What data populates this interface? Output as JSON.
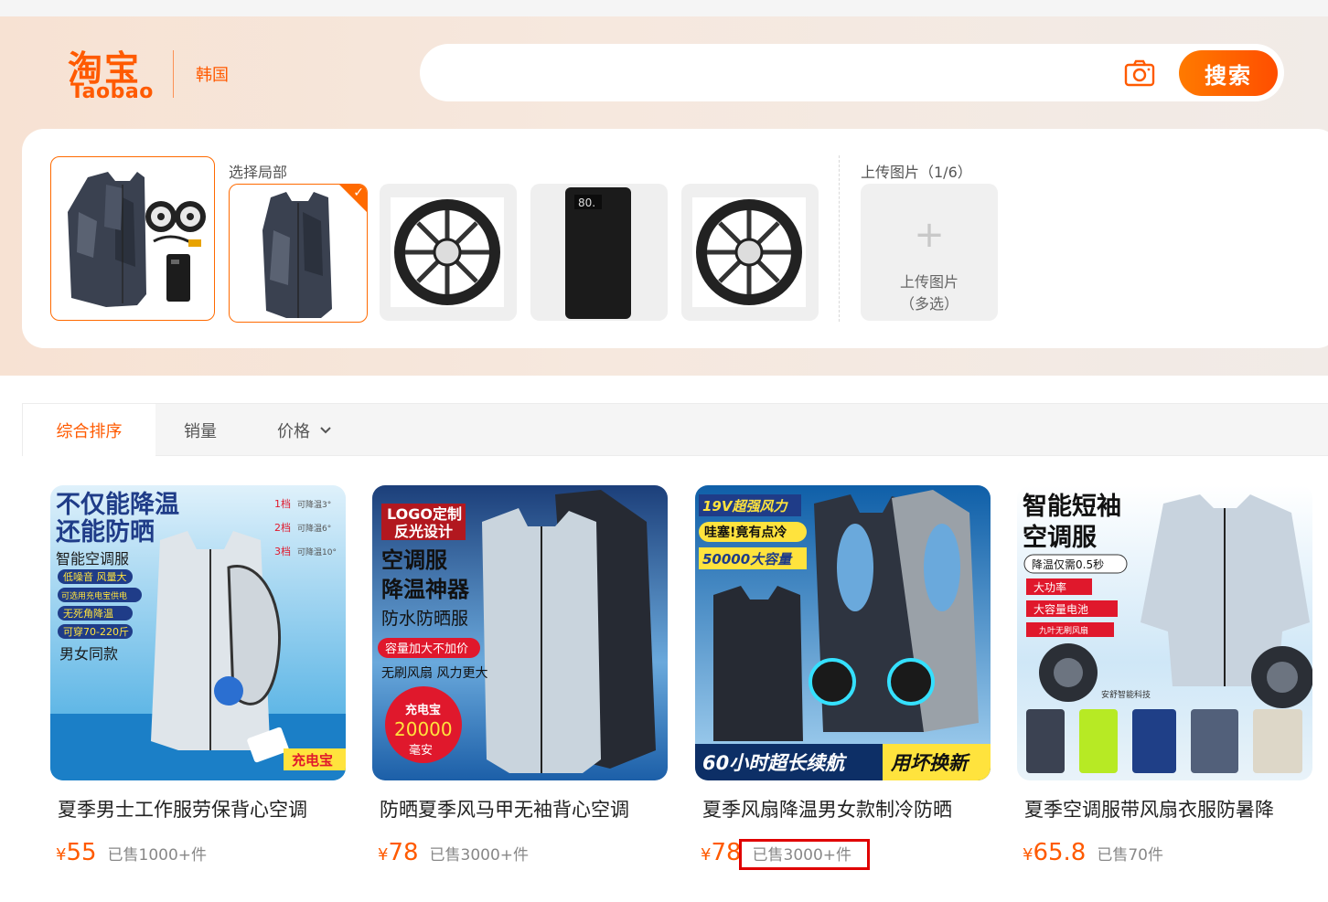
{
  "header": {
    "logo_cn": "淘宝",
    "logo_en": "Taobao",
    "region": "韩国",
    "search_placeholder": "",
    "search_button": "搜索"
  },
  "image_panel": {
    "select_area_label": "选择局部",
    "upload_label": "上传图片（1/6）",
    "upload_box_line1": "上传图片",
    "upload_box_line2": "（多选）",
    "thumbnails": [
      "vest-set",
      "vest",
      "fan",
      "power-bank",
      "fan"
    ]
  },
  "sort_bar": {
    "tabs": [
      "综合排序",
      "销量",
      "价格"
    ],
    "active_tab": "综合排序"
  },
  "products": [
    {
      "title": "夏季男士工作服劳保背心空调",
      "currency": "¥",
      "price": "55",
      "sold": "已售1000+件",
      "img_text": {
        "h1": "不仅能降温",
        "h2": "还能防晒",
        "sub1": "智能空调服",
        "tag1": "低噪音 风量大",
        "tag2": "可选用充电宝供电",
        "tag3": "无死角降温",
        "tag4": "可穿70-220斤",
        "sub2": "男女同款",
        "lvl1": "1档",
        "lvl1b": "可降温3°",
        "lvl2": "2档",
        "lvl2b": "可降温6°",
        "lvl3": "3档",
        "lvl3b": "可降温10°",
        "corner": "充电宝"
      }
    },
    {
      "title": "防晒夏季风马甲无袖背心空调",
      "currency": "¥",
      "price": "78",
      "sold": "已售3000+件",
      "img_text": {
        "logo1": "LOGO定制",
        "logo2": "反光设计",
        "h1": "空调服",
        "h2": "降温神器",
        "sub1": "防水防晒服",
        "tag1": "容量加大不加价",
        "sub2": "无刷风扇 风力更大",
        "circle1": "充电宝",
        "circle2": "20000",
        "circle3": "毫安"
      }
    },
    {
      "title": "夏季风扇降温男女款制冷防晒",
      "currency": "¥",
      "price": "78",
      "sold": "已售3000+件",
      "img_text": {
        "tag1": "19V超强风力",
        "tag2": "哇塞!竟有点冷",
        "tag3": "50000大容量",
        "banner1": "60小时超长续航",
        "banner2": "用坏换新"
      }
    },
    {
      "title": "夏季空调服带风扇衣服防暑降",
      "currency": "¥",
      "price": "65.8",
      "sold": "已售70件",
      "img_text": {
        "h1": "智能短袖",
        "h2": "空调服",
        "sub1": "降温仅需0.5秒",
        "tag1": "大功率",
        "tag2": "大容量电池",
        "tag3": "九叶无刷风扇",
        "brand": "安舒智能科技"
      }
    }
  ],
  "colors": {
    "accent": "#ff5a00",
    "highlight_box": "#e00000"
  }
}
